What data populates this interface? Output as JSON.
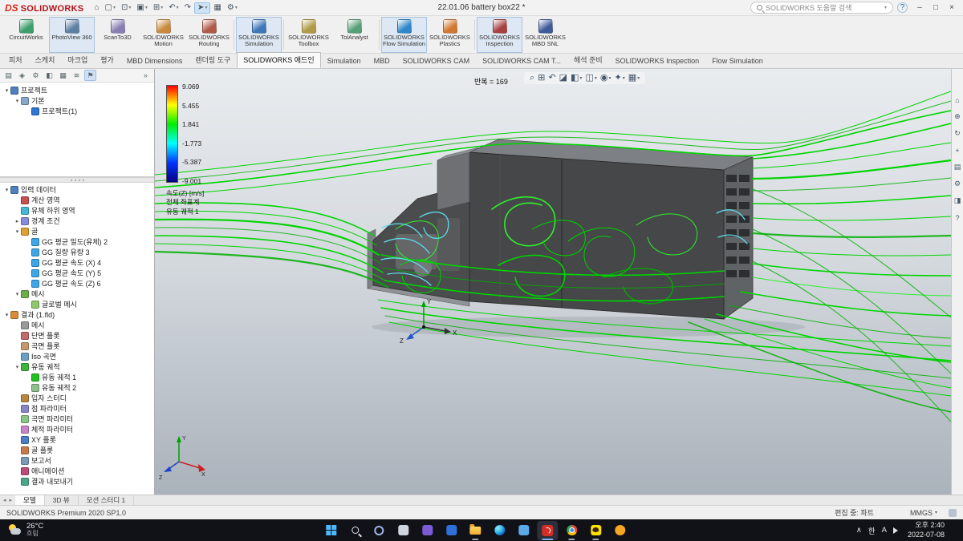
{
  "title_bar": {
    "ds_logo": "DS",
    "brand": "SOLIDWORKS",
    "document_title": "22.01.06 battery box22 *",
    "search_placeholder": "SOLIDWORKS 도움말 검색",
    "help_glyph": "?",
    "window_controls": [
      "–",
      "□",
      "×"
    ],
    "menu_icons": [
      {
        "name": "home-icon",
        "glyph": "⌂"
      },
      {
        "name": "new-document-icon",
        "glyph": "▢",
        "caret": true
      },
      {
        "name": "open-icon",
        "glyph": "⊡",
        "caret": true
      },
      {
        "name": "save-icon",
        "glyph": "▣",
        "caret": true
      },
      {
        "name": "print-icon",
        "glyph": "⊞",
        "caret": true
      },
      {
        "name": "undo-icon",
        "glyph": "↶",
        "caret": true
      },
      {
        "name": "redo-icon",
        "glyph": "↷"
      },
      {
        "name": "select-icon",
        "glyph": "➤",
        "caret": true,
        "highlighted": true
      },
      {
        "name": "rebuild-icon",
        "glyph": "▦"
      },
      {
        "name": "options-icon",
        "glyph": "⚙",
        "caret": true
      }
    ]
  },
  "addins": [
    {
      "id": "circuitworks",
      "label": "CircuitWorks",
      "color": "#3f9d6e"
    },
    {
      "id": "photoview-360",
      "label": "PhotoView 360",
      "color": "#5d7fa3",
      "active": true
    },
    {
      "id": "scanto3d",
      "label": "ScanTo3D",
      "color": "#8a7fb3"
    },
    {
      "id": "solidworks-motion",
      "label": "SOLIDWORKS Motion",
      "color": "#c98a3d"
    },
    {
      "id": "solidworks-routing",
      "label": "SOLIDWORKS Routing",
      "color": "#b05a4a"
    },
    {
      "separator": true
    },
    {
      "id": "solidworks-simulation",
      "label": "SOLIDWORKS Simulation",
      "color": "#3f76b8",
      "active": true
    },
    {
      "separator": true
    },
    {
      "id": "solidworks-toolbox",
      "label": "SOLIDWORKS Toolbox",
      "color": "#b09a45"
    },
    {
      "id": "tolanalyst",
      "label": "TolAnalyst",
      "color": "#56a078"
    },
    {
      "separator": true
    },
    {
      "id": "solidworks-flow-simulation",
      "label": "SOLIDWORKS Flow Simulation",
      "color": "#2f87c8",
      "active": true
    },
    {
      "id": "solidworks-plastics",
      "label": "SOLIDWORKS Plastics",
      "color": "#d2782f"
    },
    {
      "separator": true
    },
    {
      "id": "solidworks-inspection",
      "label": "SOLIDWORKS Inspection",
      "color": "#a84040",
      "active": true
    },
    {
      "id": "solidworks-mbd-snl",
      "label": "SOLIDWORKS MBD SNL",
      "color": "#3d5a99"
    }
  ],
  "command_tabs": [
    {
      "label": "피처"
    },
    {
      "label": "스케치"
    },
    {
      "label": "마크업"
    },
    {
      "label": "평가"
    },
    {
      "label": "MBD Dimensions"
    },
    {
      "label": "렌더링 도구"
    },
    {
      "label": "SOLIDWORKS 애드인",
      "active": true
    },
    {
      "label": "Simulation"
    },
    {
      "label": "MBD"
    },
    {
      "label": "SOLIDWORKS CAM"
    },
    {
      "label": "SOLIDWORKS CAM T..."
    },
    {
      "label": "해석 준비"
    },
    {
      "label": "SOLIDWORKS Inspection"
    },
    {
      "label": "Flow Simulation"
    }
  ],
  "panel_tabs": [
    {
      "name": "feature-manager-tab-icon",
      "glyph": "▤"
    },
    {
      "name": "property-manager-tab-icon",
      "glyph": "◈"
    },
    {
      "name": "configuration-manager-tab-icon",
      "glyph": "⚙"
    },
    {
      "name": "dimxpert-manager-tab-icon",
      "glyph": "◧"
    },
    {
      "name": "display-manager-tab-icon",
      "glyph": "▦"
    },
    {
      "name": "cam-tree-tab-icon",
      "glyph": "≋"
    },
    {
      "name": "flow-simulation-tree-tab-icon",
      "glyph": "⚑",
      "active": true
    }
  ],
  "panel_overflow_glyph": "»",
  "top_tree": [
    {
      "label": "프로젝트",
      "depth": 0,
      "arrow": "▾",
      "color": "#4f81bd"
    },
    {
      "label": "기본",
      "depth": 1,
      "arrow": "▾",
      "color": "#8aa8c8"
    },
    {
      "label": "프로젝트(1)",
      "depth": 2,
      "arrow": "",
      "color": "#2e75d4"
    }
  ],
  "flow_tree": [
    {
      "label": "입력 데이터",
      "depth": 0,
      "arrow": "▾",
      "color": "#4f81bd"
    },
    {
      "label": "계산 영역",
      "depth": 1,
      "arrow": "",
      "color": "#c75050"
    },
    {
      "label": "유체 하위 영역",
      "depth": 1,
      "arrow": "",
      "color": "#45b8d8"
    },
    {
      "label": "경계 조건",
      "depth": 1,
      "arrow": "▸",
      "color": "#8a8adf"
    },
    {
      "label": "골",
      "depth": 1,
      "arrow": "▾",
      "color": "#e0a030"
    },
    {
      "label": "GG 평균 밀도(유체) 2",
      "depth": 2,
      "arrow": "",
      "color": "#3da5e8"
    },
    {
      "label": "GG 질량 유량 3",
      "depth": 2,
      "arrow": "",
      "color": "#3da5e8"
    },
    {
      "label": "GG 평균 속도 (X) 4",
      "depth": 2,
      "arrow": "",
      "color": "#3da5e8"
    },
    {
      "label": "GG 평균 속도 (Y) 5",
      "depth": 2,
      "arrow": "",
      "color": "#3da5e8"
    },
    {
      "label": "GG 평균 속도 (Z) 6",
      "depth": 2,
      "arrow": "",
      "color": "#3da5e8"
    },
    {
      "label": "메시",
      "depth": 1,
      "arrow": "▾",
      "color": "#6fae4a"
    },
    {
      "label": "글로벌 메시",
      "depth": 2,
      "arrow": "",
      "color": "#8fc86a"
    },
    {
      "label": "결과 (1.fld)",
      "depth": 0,
      "arrow": "▾",
      "color": "#d98a3a"
    },
    {
      "label": "메시",
      "depth": 1,
      "arrow": "",
      "color": "#9a9a9a"
    },
    {
      "label": "단면 플롯",
      "depth": 1,
      "arrow": "",
      "color": "#c46a6a"
    },
    {
      "label": "곡면 플롯",
      "depth": 1,
      "arrow": "",
      "color": "#c49a6a"
    },
    {
      "label": "Iso 곡면",
      "depth": 1,
      "arrow": "",
      "color": "#6aa0c4"
    },
    {
      "label": "유동 궤적",
      "depth": 1,
      "arrow": "▾",
      "color": "#3fb53f"
    },
    {
      "label": "유동 궤적 1",
      "depth": 2,
      "arrow": "",
      "color": "#20c020"
    },
    {
      "label": "유동 궤적 2",
      "depth": 2,
      "arrow": "",
      "color": "#8fbf8f"
    },
    {
      "label": "입자 스터디",
      "depth": 1,
      "arrow": "",
      "color": "#b8863f"
    },
    {
      "label": "점 파라미터",
      "depth": 1,
      "arrow": "",
      "color": "#8585c8"
    },
    {
      "label": "곡면 파라미터",
      "depth": 1,
      "arrow": "",
      "color": "#85c885"
    },
    {
      "label": "체적 파라미터",
      "depth": 1,
      "arrow": "",
      "color": "#c885c8"
    },
    {
      "label": "XY 플롯",
      "depth": 1,
      "arrow": "",
      "color": "#4a7ec8"
    },
    {
      "label": "골 플롯",
      "depth": 1,
      "arrow": "",
      "color": "#c87a4a"
    },
    {
      "label": "보고서",
      "depth": 1,
      "arrow": "",
      "color": "#7a9ab8"
    },
    {
      "label": "애니메이션",
      "depth": 1,
      "arrow": "",
      "color": "#c04a7a"
    },
    {
      "label": "결과 내보내기",
      "depth": 1,
      "arrow": "",
      "color": "#4aa88a"
    }
  ],
  "legend": {
    "values": [
      "9.069",
      "5.455",
      "1.841",
      "-1.773",
      "-5.387",
      "-9.001"
    ],
    "captions": [
      "속도(Z) [m/s]",
      "전체 좌표계",
      "유동 궤적 1"
    ],
    "colors": [
      "#ff0000",
      "#ffff00",
      "#00ee00",
      "#00ffff",
      "#0033ff",
      "#000080"
    ]
  },
  "viewport": {
    "solver_text": "반복 = 169",
    "axis_x": "X",
    "axis_y": "Y",
    "axis_z": "Z"
  },
  "headsup_icons": [
    {
      "name": "zoom-fit-icon",
      "glyph": "⌕"
    },
    {
      "name": "zoom-area-icon",
      "glyph": "⊞"
    },
    {
      "name": "previous-view-icon",
      "glyph": "↶"
    },
    {
      "name": "section-view-icon",
      "glyph": "◪"
    },
    {
      "name": "view-orientation-icon",
      "glyph": "◧",
      "caret": true
    },
    {
      "name": "display-style-icon",
      "glyph": "◫",
      "caret": true
    },
    {
      "name": "hide-show-items-icon",
      "glyph": "◉",
      "caret": true
    },
    {
      "name": "edit-appearance-icon",
      "glyph": "✦",
      "caret": true
    },
    {
      "name": "view-settings-icon",
      "glyph": "▦",
      "caret": true
    }
  ],
  "right_toolbar": [
    {
      "name": "home-view-icon",
      "glyph": "⌂"
    },
    {
      "name": "zoom-icon",
      "glyph": "⊕"
    },
    {
      "name": "rotate-view-icon",
      "glyph": "↻"
    },
    {
      "name": "pan-icon",
      "glyph": "+"
    },
    {
      "name": "mesh-display-icon",
      "glyph": "▤"
    },
    {
      "name": "flow-options-icon",
      "glyph": "⚙"
    },
    {
      "name": "section-icon",
      "glyph": "◨"
    },
    {
      "name": "help-icon",
      "glyph": "?"
    }
  ],
  "model_tabs": {
    "arrow_left": "◂",
    "arrow_right": "▸",
    "items": [
      {
        "label": "모델",
        "active": true
      },
      {
        "label": "3D 뷰"
      },
      {
        "label": "모션 스터디 1"
      }
    ]
  },
  "status_bar": {
    "left": "SOLIDWORKS Premium 2020 SP1.0",
    "editing": "편집 중: 파트",
    "units": "MMGS",
    "caret": "▾"
  },
  "taskbar": {
    "weather_temp": "26°C",
    "weather_desc": "흐림",
    "icons": [
      {
        "name": "start-button",
        "shape": "windows"
      },
      {
        "name": "search-button",
        "shape": "lens"
      },
      {
        "name": "copilot-icon",
        "shape": "ring"
      },
      {
        "name": "task-view-icon",
        "shape": "square",
        "color": "#cfd6e0"
      },
      {
        "name": "store-icon",
        "shape": "square",
        "color": "#7b5cd6"
      },
      {
        "name": "mail-icon",
        "shape": "square",
        "color": "#2f6fd8"
      },
      {
        "name": "file-explorer-icon",
        "shape": "folder",
        "running": true
      },
      {
        "name": "edge-icon",
        "shape": "edge"
      },
      {
        "name": "photos-icon",
        "shape": "square",
        "color": "#5aa9e6"
      },
      {
        "name": "solidworks-icon",
        "shape": "sw",
        "active": true,
        "running": true
      },
      {
        "name": "chrome-icon",
        "shape": "chrome",
        "running": true
      },
      {
        "name": "kakaotalk-icon",
        "shape": "kakao",
        "running": true
      },
      {
        "name": "player-icon",
        "shape": "circle",
        "color": "#f5a623"
      }
    ],
    "tray": {
      "chevron": "∧",
      "ime": "한",
      "ime2": "A"
    },
    "time": "오후 2:40",
    "date": "2022-07-08"
  }
}
